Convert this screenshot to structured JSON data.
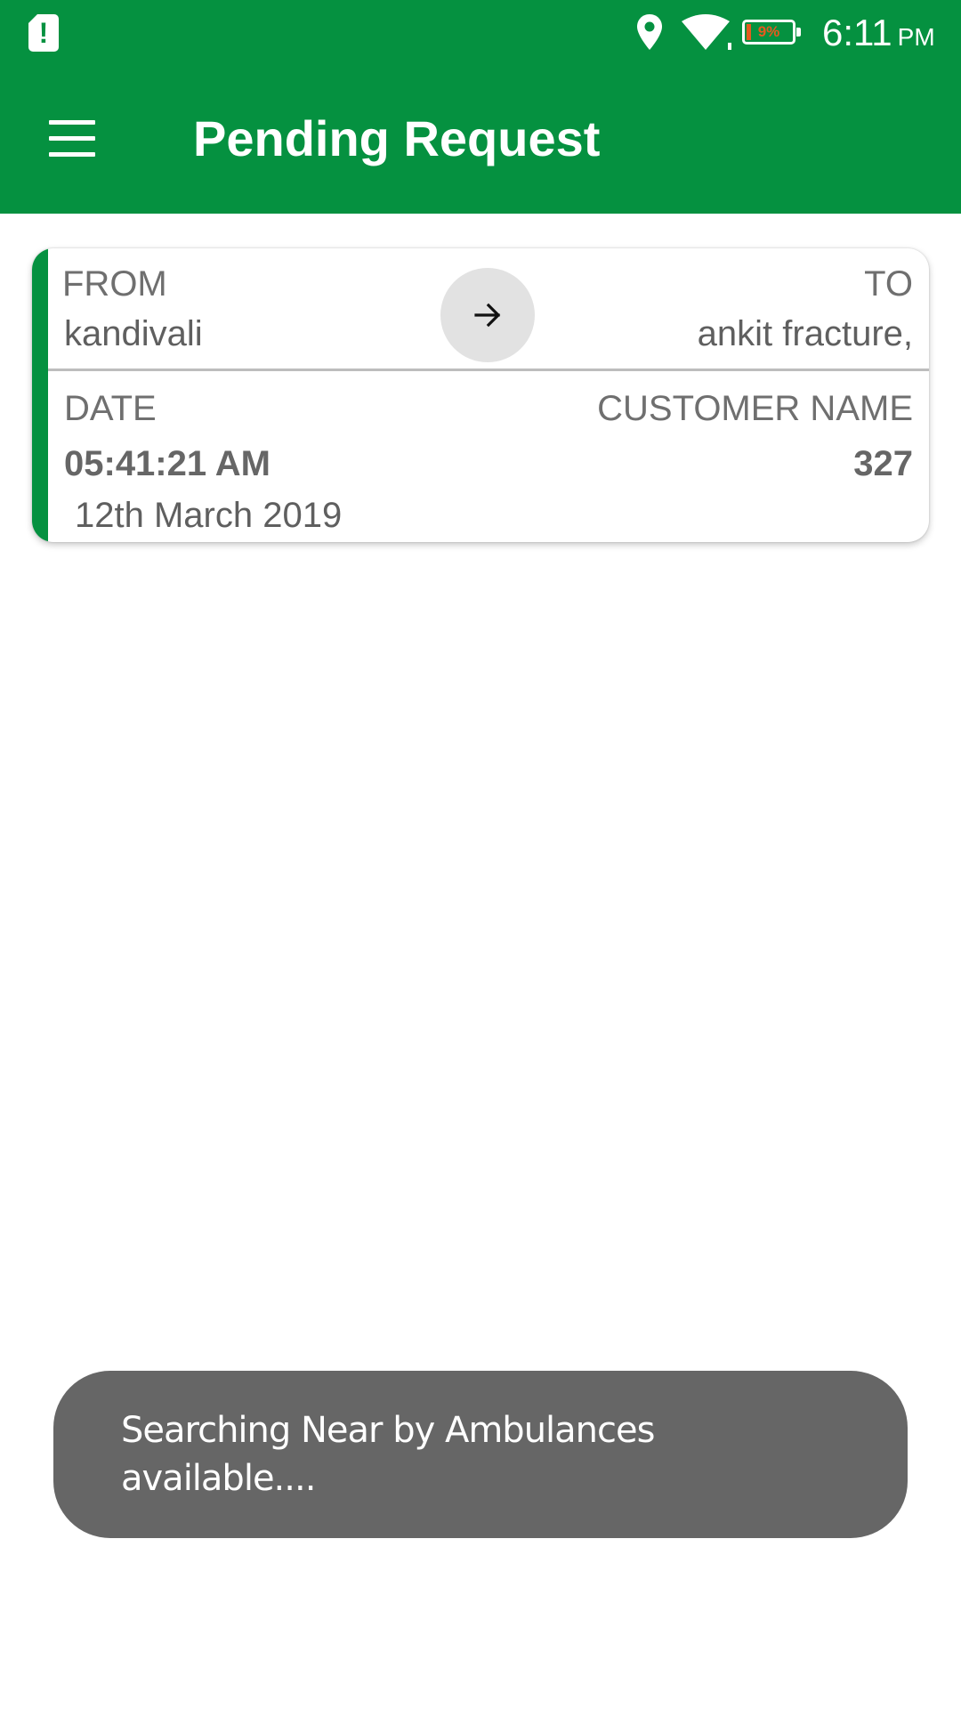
{
  "status_bar": {
    "time": "6:11",
    "ampm": "PM",
    "battery_percent_text": "9%",
    "battery_level": 0.09,
    "icons": [
      "alert-icon",
      "location-icon",
      "wifi-icon",
      "battery-icon"
    ]
  },
  "app_bar": {
    "menu_icon": "hamburger-menu-icon",
    "title": "Pending Request"
  },
  "request_card": {
    "from_label": "FROM",
    "from_value": "kandivali",
    "to_label": "TO",
    "to_value": "ankit fracture,",
    "arrow_icon": "arrow-right-icon",
    "date_label": "DATE",
    "time_value": "05:41:21 AM",
    "date_value": "12th March 2019",
    "customer_label": "CUSTOMER NAME",
    "customer_value": "327"
  },
  "toast": {
    "message": "Searching Near by Ambulances available...."
  },
  "colors": {
    "primary_green": "#059140",
    "toast_bg": "#666666",
    "battery_low": "#e65a1e"
  }
}
